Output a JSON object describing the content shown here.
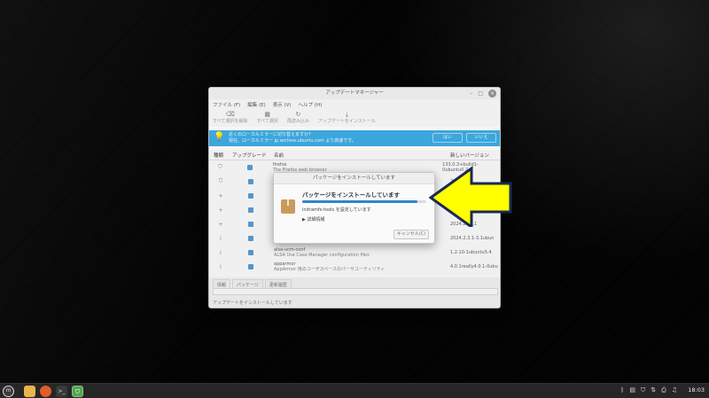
{
  "window": {
    "title": "アップデートマネージャー",
    "controls": {
      "minimize": "–",
      "maximize": "□",
      "close": "×"
    },
    "menu": [
      "ファイル (F)",
      "編集 (E)",
      "表示 (V)",
      "ヘルプ (H)"
    ],
    "toolbar": [
      {
        "icon": "eraser-icon",
        "glyph": "⌫",
        "label": "すべて選択を解除"
      },
      {
        "icon": "select-all-icon",
        "glyph": "▦",
        "label": "すべて選択"
      },
      {
        "icon": "refresh-icon",
        "glyph": "↻",
        "label": "再読み込み"
      },
      {
        "icon": "install-icon",
        "glyph": "⤓",
        "label": "アップデートをインストール"
      }
    ],
    "infobar": {
      "line1": "近くのローカルミラーに切り替えますか?",
      "line2": "現在、ローカルミラー jp.archive.ubuntu.com より高速です。",
      "yes": "はい",
      "no": "いいえ"
    },
    "columns": {
      "type": "種類",
      "upgrade": "アップグレード",
      "name": "名前",
      "version": "新しいバージョン"
    },
    "rows": [
      {
        "type_icon": "shield-icon",
        "glyph": "⛉",
        "name": "firefox",
        "desc": "The Firefox web browser",
        "version": "133.0.3+build1-0ubuntu0.2"
      },
      {
        "type_icon": "shield-icon",
        "glyph": "⛉",
        "name": "",
        "desc": "",
        "version": "2024.2"
      },
      {
        "type_icon": "package-icon",
        "glyph": "+",
        "name": "",
        "desc": "",
        "version": ""
      },
      {
        "type_icon": "package-icon",
        "glyph": "+",
        "name": "",
        "desc": "",
        "version": ""
      },
      {
        "type_icon": "package-icon",
        "glyph": "+",
        "name": "",
        "desc": "",
        "version": "2024.2.04.1"
      },
      {
        "type_icon": "info-icon",
        "glyph": "i",
        "name": "",
        "desc": "",
        "version": "2024.2.3.1-3.1ubun"
      },
      {
        "type_icon": "info-icon",
        "glyph": "i",
        "name": "alsa-ucm-conf",
        "desc": "ALSA Use Case Manager configuration files",
        "version": "1.2.10-1ubuntu5.4"
      },
      {
        "type_icon": "info-icon",
        "glyph": "i",
        "name": "apparmor",
        "desc": "AppArmor 用のユーザスペースのパーサユーティリティ",
        "version": "4.0.1really4.0.1-0ubu"
      }
    ],
    "tabs": [
      "情報",
      "パッケージ",
      "更新履歴"
    ],
    "status": "アップデートをインストールしています"
  },
  "dialog": {
    "title": "パッケージをインストールしています",
    "heading": "パッケージをインストールしています",
    "progress": 0.93,
    "sub": "initramfs-tools を設定しています",
    "details": "詳細情報",
    "cancel": "キャンセル(C)"
  },
  "annotation": {
    "color": "#ffff00",
    "outline": "#1a2a55"
  },
  "panel": {
    "launchers": [
      "menu-icon",
      "files-icon",
      "firefox-icon",
      "terminal-icon",
      "update-manager-icon"
    ],
    "tray": [
      "bluetooth-icon",
      "clipboard-icon",
      "shield-tray-icon",
      "network-icon",
      "printer-icon",
      "sound-icon"
    ],
    "clock": "18:03"
  }
}
